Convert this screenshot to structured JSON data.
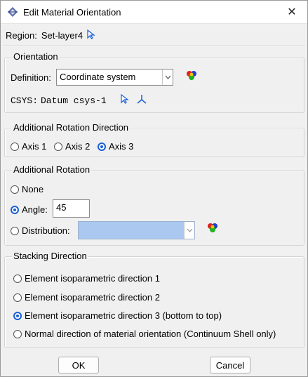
{
  "window": {
    "title": "Edit Material Orientation",
    "close_glyph": "✕"
  },
  "region": {
    "label": "Region:",
    "value": "Set-layer4"
  },
  "orientation": {
    "group_title": "Orientation",
    "definition_label": "Definition:",
    "definition_value": "Coordinate system",
    "csys_label": "CSYS:",
    "csys_value": "Datum csys-1"
  },
  "rotation_direction": {
    "group_title": "Additional Rotation Direction",
    "options": [
      "Axis 1",
      "Axis 2",
      "Axis 3"
    ],
    "selected": "Axis 3"
  },
  "rotation": {
    "group_title": "Additional Rotation",
    "none_label": "None",
    "angle_label": "Angle:",
    "angle_value": "45",
    "distribution_label": "Distribution:",
    "selected": "Angle:"
  },
  "stacking": {
    "group_title": "Stacking Direction",
    "options": [
      "Element isoparametric direction 1",
      "Element isoparametric direction 2",
      "Element isoparametric direction 3 (bottom to top)",
      "Normal direction of material orientation (Continuum Shell only)"
    ],
    "selected_index": 2
  },
  "buttons": {
    "ok": "OK",
    "cancel": "Cancel"
  },
  "colors": {
    "accent": "#1a5fd6",
    "distribution_fill": "#aac8f0"
  }
}
